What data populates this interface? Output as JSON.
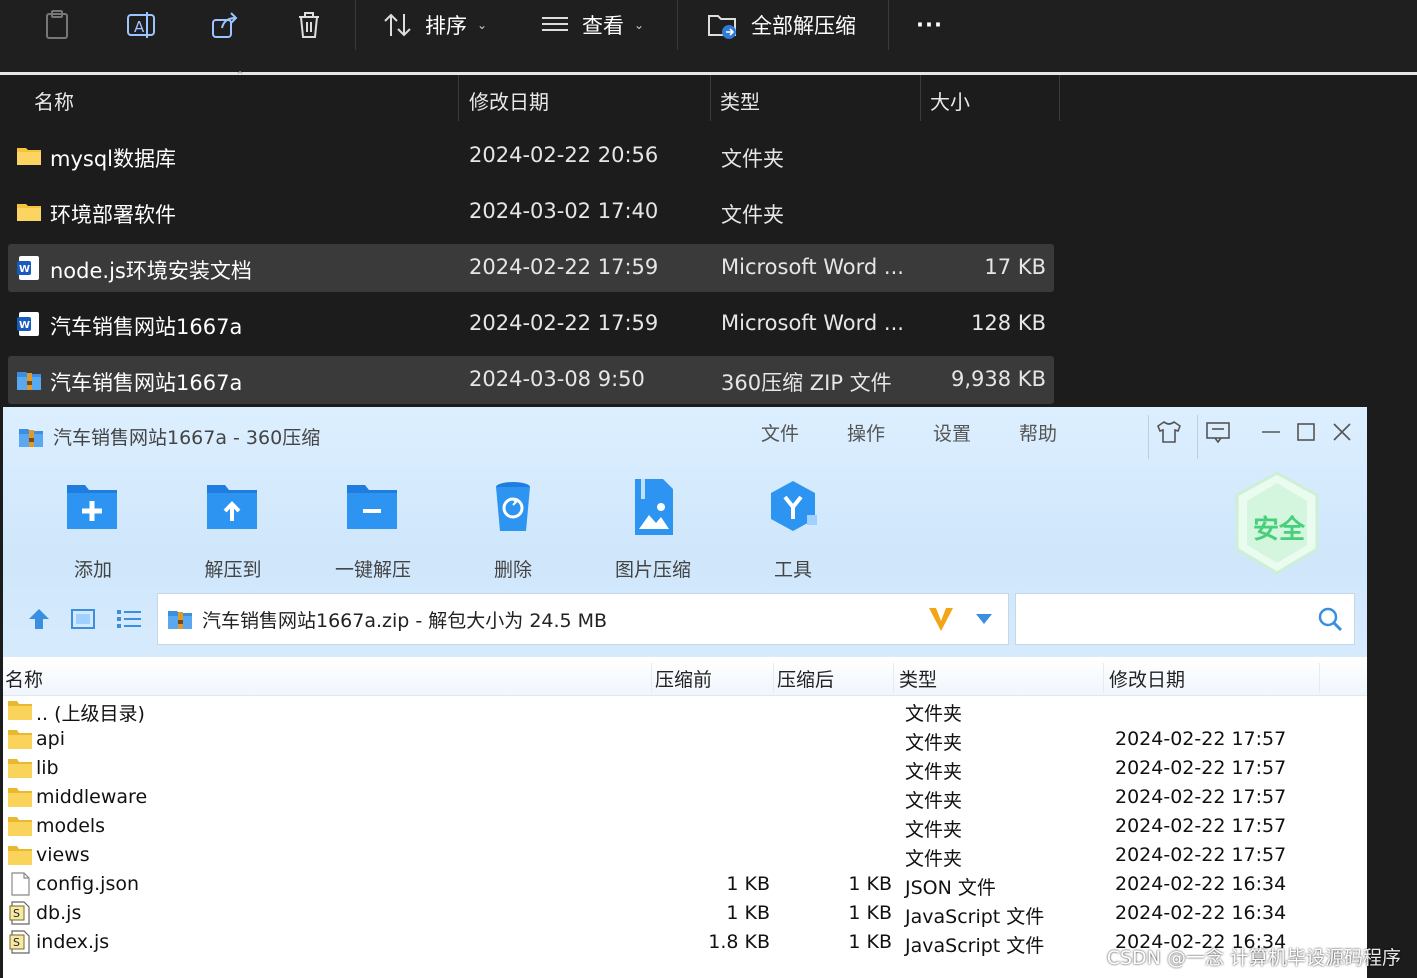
{
  "explorer": {
    "cmdbar": {
      "sort_label": "排序",
      "view_label": "查看",
      "extract_all_label": "全部解压缩",
      "more_label": "···"
    },
    "columns": {
      "name": "名称",
      "date": "修改日期",
      "type": "类型",
      "size": "大小"
    },
    "rows": [
      {
        "name": "mysql数据库",
        "date": "2024-02-22 20:56",
        "type": "文件夹",
        "size": "",
        "icon": "folder-icon",
        "selected": false
      },
      {
        "name": "环境部署软件",
        "date": "2024-03-02 17:40",
        "type": "文件夹",
        "size": "",
        "icon": "folder-icon",
        "selected": false
      },
      {
        "name": "node.js环境安装文档",
        "date": "2024-02-22 17:59",
        "type": "Microsoft Word ...",
        "size": "17 KB",
        "icon": "word-doc-icon",
        "selected": true
      },
      {
        "name": "汽车销售网站1667a",
        "date": "2024-02-22 17:59",
        "type": "Microsoft Word ...",
        "size": "128 KB",
        "icon": "word-doc-icon",
        "selected": false
      },
      {
        "name": "汽车销售网站1667a",
        "date": "2024-03-08 9:50",
        "type": "360压缩 ZIP 文件",
        "size": "9,938 KB",
        "icon": "zip-archive-icon",
        "selected": true
      }
    ]
  },
  "zip": {
    "title": "汽车销售网站1667a - 360压缩",
    "menu": [
      "文件",
      "操作",
      "设置",
      "帮助"
    ],
    "tools": [
      "添加",
      "解压到",
      "一键解压",
      "删除",
      "图片压缩",
      "工具"
    ],
    "safe_badge": "安全",
    "path_text": "汽车销售网站1667a.zip - 解包大小为 24.5 MB",
    "search_placeholder": "",
    "columns": {
      "name": "名称",
      "before": "压缩前",
      "after": "压缩后",
      "type": "类型",
      "date": "修改日期"
    },
    "rows": [
      {
        "name": ".. (上级目录)",
        "before": "",
        "after": "",
        "type": "文件夹",
        "date": "",
        "icon": "folder-icon"
      },
      {
        "name": "api",
        "before": "",
        "after": "",
        "type": "文件夹",
        "date": "2024-02-22 17:57",
        "icon": "folder-icon"
      },
      {
        "name": "lib",
        "before": "",
        "after": "",
        "type": "文件夹",
        "date": "2024-02-22 17:57",
        "icon": "folder-icon"
      },
      {
        "name": "middleware",
        "before": "",
        "after": "",
        "type": "文件夹",
        "date": "2024-02-22 17:57",
        "icon": "folder-icon"
      },
      {
        "name": "models",
        "before": "",
        "after": "",
        "type": "文件夹",
        "date": "2024-02-22 17:57",
        "icon": "folder-icon"
      },
      {
        "name": "views",
        "before": "",
        "after": "",
        "type": "文件夹",
        "date": "2024-02-22 17:57",
        "icon": "folder-icon"
      },
      {
        "name": "config.json",
        "before": "1 KB",
        "after": "1 KB",
        "type": "JSON 文件",
        "date": "2024-02-22 16:34",
        "icon": "blank-file-icon"
      },
      {
        "name": "db.js",
        "before": "1 KB",
        "after": "1 KB",
        "type": "JavaScript 文件",
        "date": "2024-02-22 16:34",
        "icon": "script-file-icon"
      },
      {
        "name": "index.js",
        "before": "1.8 KB",
        "after": "1 KB",
        "type": "JavaScript 文件",
        "date": "2024-02-22 16:34",
        "icon": "script-file-icon"
      }
    ]
  },
  "watermark": "CSDN @一念 计算机毕设源码程序"
}
